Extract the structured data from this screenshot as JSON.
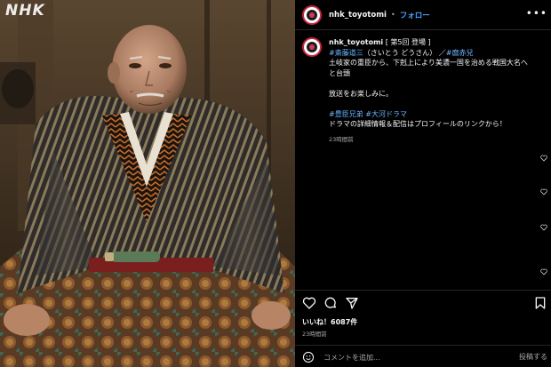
{
  "photo": {
    "watermark": "NHK"
  },
  "header": {
    "username": "nhk_toyotomi",
    "separator": "•",
    "follow_label": "フォロー",
    "more_label": "•••"
  },
  "caption": {
    "username": "nhk_toyotomi",
    "title": "[ 第5回 登場 ]",
    "tag_person": "#斎藤道三",
    "reading": "（さいとう どうさん）",
    "slash": "／",
    "tag_actor": "#麿赤兒",
    "line1": "土岐家の重臣から、下剋上により美濃一国を治める戦国大名へ",
    "line2": "と台頭",
    "line3": "放送をお楽しみに。",
    "tag_show": "#豊臣兄弟",
    "tag_genre": "#大河ドラマ",
    "line4": "ドラマの詳細情報＆配信はプロフィールのリンクから！",
    "time": "23時間前"
  },
  "actions": {
    "like_icon": "heart-icon",
    "comment_icon": "comment-icon",
    "share_icon": "share-icon",
    "save_icon": "bookmark-icon"
  },
  "likes_text": "いいね！6087件",
  "post_time": "23時間前",
  "comment": {
    "placeholder": "コメントを追加...",
    "post_label": "投稿する"
  },
  "colors": {
    "accent": "#4aa3ff",
    "hashtag": "#6db3ff",
    "muted": "#a8a8a8",
    "background": "#000000"
  }
}
